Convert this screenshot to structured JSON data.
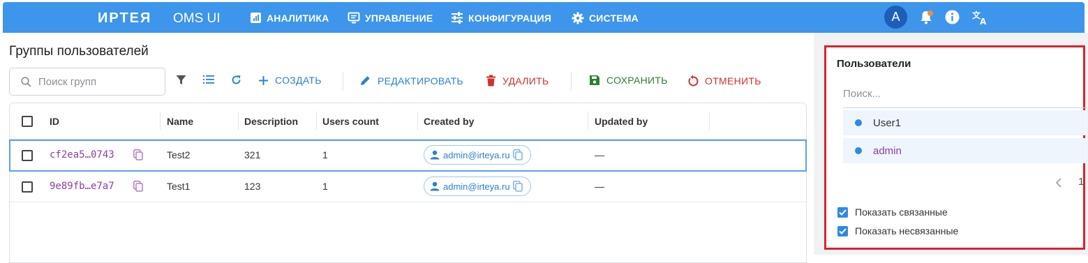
{
  "topbar": {
    "logo": "ИРТЕЯ",
    "app_name": "OMS UI",
    "nav": [
      {
        "label": "АНАЛИТИКА",
        "icon": "chart-icon"
      },
      {
        "label": "УПРАВЛЕНИЕ",
        "icon": "manage-icon"
      },
      {
        "label": "КОНФИГУРАЦИЯ",
        "icon": "sliders-icon"
      },
      {
        "label": "СИСТЕМА",
        "icon": "gear-icon"
      }
    ],
    "avatar_letter": "A",
    "icons": [
      "bell-icon",
      "info-icon",
      "translate-icon"
    ]
  },
  "page": {
    "title": "Группы пользователей"
  },
  "toolbar": {
    "search_placeholder": "Поиск групп",
    "create": "СОЗДАТЬ",
    "edit": "РЕДАКТИРОВАТЬ",
    "delete": "УДАЛИТЬ",
    "save": "СОХРАНИТЬ",
    "cancel": "ОТМЕНИТЬ"
  },
  "colors": {
    "accent": "#3d95ec",
    "danger": "#d32f2f",
    "success": "#2e7d32",
    "id_color": "#8b3fa6",
    "panel_border": "#d9232f"
  },
  "table": {
    "columns": [
      "ID",
      "Name",
      "Description",
      "Users count",
      "Created by",
      "Updated by"
    ],
    "rows": [
      {
        "id": "cf2ea5…0743",
        "name": "Test2",
        "description": "321",
        "users_count": "1",
        "created_by": "admin@irteya.ru",
        "updated_by": "—",
        "selected": true
      },
      {
        "id": "9e89fb…e7a7",
        "name": "Test1",
        "description": "123",
        "users_count": "1",
        "created_by": "admin@irteya.ru",
        "updated_by": "—",
        "selected": false
      }
    ]
  },
  "users_panel": {
    "title": "Пользователи",
    "search_placeholder": "Поиск...",
    "users": [
      "User1",
      "admin"
    ],
    "page": "1",
    "show_linked": "Показать связанные",
    "show_unlinked": "Показать несвязанные"
  }
}
